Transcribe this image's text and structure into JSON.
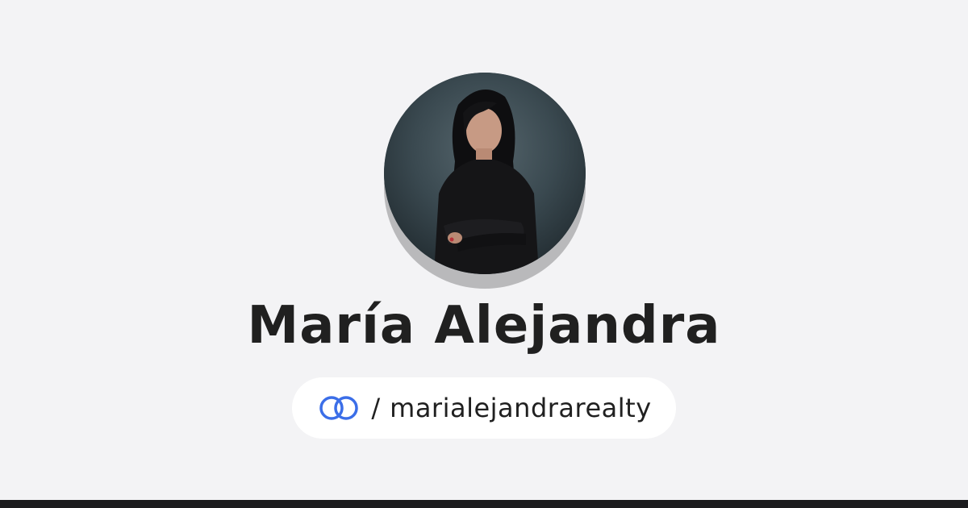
{
  "profile": {
    "name": "María Alejandra",
    "avatar_alt": "profile-photo"
  },
  "handle": {
    "separator": "/",
    "username": "marialejandrarealty",
    "logo_icon": "linked-rings-icon"
  },
  "colors": {
    "background": "#f3f3f5",
    "text": "#202020",
    "logo_blue": "#3b6ee8",
    "bottom_bar": "#1c1c1e"
  }
}
